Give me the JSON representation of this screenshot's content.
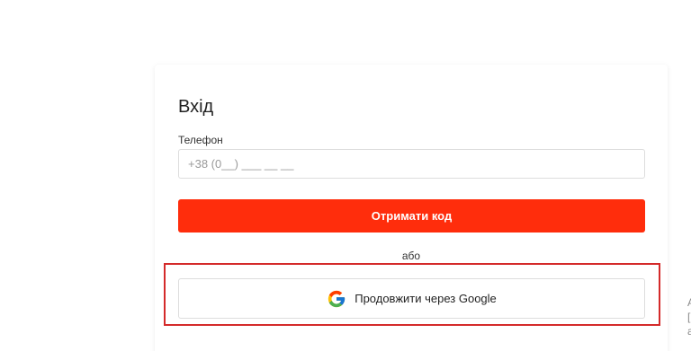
{
  "login": {
    "title": "Вхід",
    "phone_label": "Телефон",
    "phone_placeholder": "+38 (0__) ___ __ __",
    "get_code_label": "Отримати код",
    "or_text": "або",
    "google_label": "Продовжити через Google"
  },
  "colors": {
    "accent": "#ff2d0c",
    "highlight": "#d42a2a"
  },
  "icons": {
    "google": "google-logo-icon"
  }
}
